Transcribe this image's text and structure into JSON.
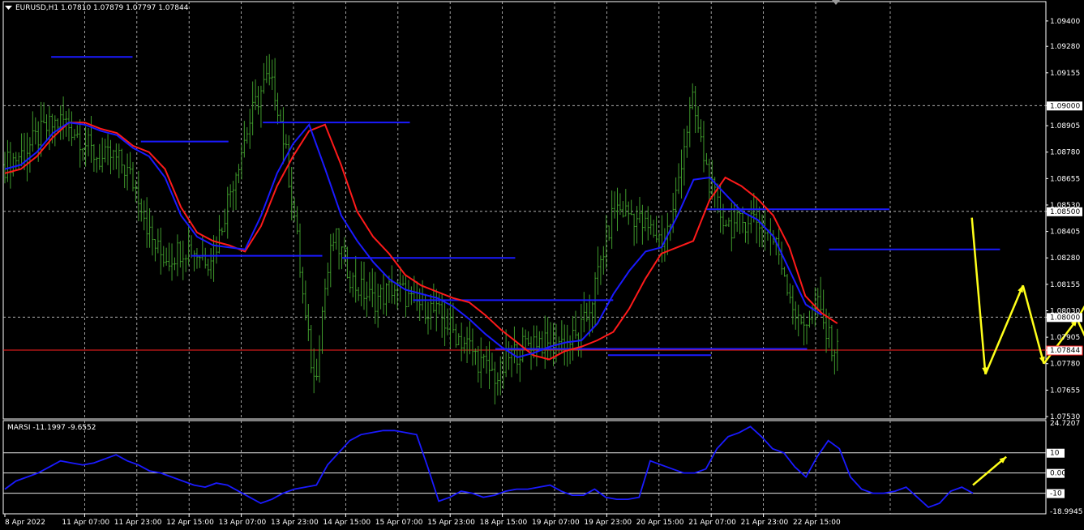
{
  "header": {
    "title": "EURUSD,H1  1.07810 1.07879 1.07797 1.07844"
  },
  "indicator_header": {
    "title": "MARSI -11.1997 -9.6552"
  },
  "colors": {
    "background": "#000000",
    "frame": "#ffffff",
    "grid": "#c8c8c8",
    "candles": "#3f9a2c",
    "ma_fast": "#1a1aff",
    "ma_slow": "#ff1a1a",
    "levels": "#1a1aff",
    "price_line": "#ff2020",
    "arrows": "#ffff1a",
    "rsi": "#1a1aff"
  },
  "chart_data": [
    {
      "type": "candlestick",
      "symbol": "EURUSD",
      "timeframe": "H1",
      "ohlc_last": {
        "open": 1.0781,
        "high": 1.07879,
        "low": 1.07797,
        "close": 1.07844
      },
      "ylim": [
        1.0753,
        1.0948
      ],
      "y_ticks": [
        "1.09400",
        "1.09280",
        "1.09155",
        "1.09000",
        "1.08905",
        "1.08780",
        "1.08655",
        "1.08530",
        "1.08500",
        "1.08405",
        "1.08280",
        "1.08155",
        "1.08030",
        "1.08000",
        "1.07905",
        "1.07844",
        "1.07780",
        "1.07655",
        "1.07530"
      ],
      "boxed_ticks": [
        "1.09000",
        "1.08500",
        "1.08000"
      ],
      "current_price": "1.07844",
      "x_ticks": [
        "8 Apr 2022",
        "11 Apr 07:00",
        "11 Apr 23:00",
        "12 Apr 15:00",
        "13 Apr 07:00",
        "13 Apr 23:00",
        "14 Apr 15:00",
        "15 Apr 07:00",
        "15 Apr 23:00",
        "18 Apr 15:00",
        "19 Apr 07:00",
        "19 Apr 23:00",
        "20 Apr 15:00",
        "21 Apr 07:00",
        "21 Apr 23:00",
        "22 Apr 15:00"
      ],
      "close_path": [
        1.0872,
        1.0875,
        1.0878,
        1.0883,
        1.0888,
        1.0891,
        1.0893,
        1.0889,
        1.0884,
        1.0878,
        1.0874,
        1.0876,
        1.0873,
        1.0866,
        1.0856,
        1.0838,
        1.083,
        1.0828,
        1.0832,
        1.0833,
        1.083,
        1.0828,
        1.0836,
        1.0855,
        1.0872,
        1.0888,
        1.0902,
        1.0912,
        1.0906,
        1.0878,
        1.0845,
        1.08,
        1.0768,
        1.0812,
        1.0838,
        1.0828,
        1.0816,
        1.0812,
        1.0808,
        1.081,
        1.0814,
        1.0812,
        1.0807,
        1.0806,
        1.0804,
        1.08,
        1.0795,
        1.079,
        1.0786,
        1.0779,
        1.0775,
        1.0771,
        1.0781,
        1.0784,
        1.0788,
        1.079,
        1.0786,
        1.0789,
        1.0788,
        1.079,
        1.0798,
        1.0815,
        1.0835,
        1.0852,
        1.085,
        1.0848,
        1.0843,
        1.084,
        1.0836,
        1.0848,
        1.0878,
        1.0902,
        1.088,
        1.086,
        1.0848,
        1.0843,
        1.0844,
        1.0848,
        1.0845,
        1.084,
        1.083,
        1.0813,
        1.0796,
        1.08,
        1.0805,
        1.079,
        1.0784
      ],
      "ma_fast": [
        1.087,
        1.0872,
        1.0878,
        1.0887,
        1.0892,
        1.0891,
        1.0888,
        1.0886,
        1.088,
        1.0876,
        1.0866,
        1.0848,
        1.0838,
        1.0834,
        1.0833,
        1.0832,
        1.0848,
        1.0868,
        1.0882,
        1.0891,
        1.087,
        1.0848,
        1.0836,
        1.0826,
        1.0818,
        1.0813,
        1.0811,
        1.0809,
        1.0805,
        1.0799,
        1.0792,
        1.0786,
        1.0781,
        1.0783,
        1.0786,
        1.0788,
        1.0789,
        1.0797,
        1.0811,
        1.0822,
        1.0831,
        1.0833,
        1.0848,
        1.0865,
        1.0866,
        1.0858,
        1.085,
        1.0846,
        1.0838,
        1.0822,
        1.0806,
        1.0801
      ],
      "ma_slow": [
        1.0868,
        1.087,
        1.0876,
        1.0885,
        1.0892,
        1.0892,
        1.0889,
        1.0887,
        1.0881,
        1.0878,
        1.087,
        1.0852,
        1.084,
        1.0836,
        1.0834,
        1.0831,
        1.0843,
        1.0862,
        1.0876,
        1.0888,
        1.0891,
        1.0872,
        1.085,
        1.0838,
        1.083,
        1.082,
        1.0815,
        1.0812,
        1.0809,
        1.0807,
        1.0801,
        1.0794,
        1.0788,
        1.0782,
        1.078,
        1.0784,
        1.0786,
        1.0789,
        1.0793,
        1.0804,
        1.0818,
        1.083,
        1.0833,
        1.0836,
        1.0855,
        1.0866,
        1.0862,
        1.0856,
        1.0848,
        1.0833,
        1.081,
        1.0802,
        1.0797
      ],
      "levels": [
        {
          "x": [
            0.046,
            0.124
          ],
          "y": 1.0923
        },
        {
          "x": [
            0.132,
            0.216
          ],
          "y": 1.0883
        },
        {
          "x": [
            0.18,
            0.306
          ],
          "y": 1.0829
        },
        {
          "x": [
            0.249,
            0.39
          ],
          "y": 1.0892
        },
        {
          "x": [
            0.325,
            0.491
          ],
          "y": 1.0828
        },
        {
          "x": [
            0.393,
            0.585
          ],
          "y": 1.0808
        },
        {
          "x": [
            0.472,
            0.771
          ],
          "y": 1.0785
        },
        {
          "x": [
            0.58,
            0.679
          ],
          "y": 1.0782
        },
        {
          "x": [
            0.673,
            0.85
          ],
          "y": 1.0851
        },
        {
          "x": [
            0.792,
            0.956
          ],
          "y": 1.0832
        }
      ],
      "arrows": [
        {
          "from": [
            0.929,
            1.0847
          ],
          "to": [
            0.942,
            1.0773
          ]
        },
        {
          "from": [
            0.942,
            1.0773
          ],
          "to": [
            0.978,
            1.0815
          ]
        },
        {
          "from": [
            0.978,
            1.0815
          ],
          "to": [
            0.998,
            1.0778
          ]
        },
        {
          "from": [
            0.998,
            1.0778
          ],
          "to": [
            1.03,
            1.0799
          ]
        },
        {
          "from": [
            1.03,
            1.0799
          ],
          "to": [
            1.055,
            1.0772
          ]
        },
        {
          "from": [
            1.03,
            1.0799
          ],
          "to": [
            1.05,
            1.0816
          ]
        }
      ]
    },
    {
      "type": "line",
      "name": "MARSI",
      "values_last": [
        -11.1997,
        -9.6552
      ],
      "ylim": [
        -18.9945,
        24.7207
      ],
      "y_ticks": [
        "24.7207",
        "10",
        "0.00",
        "-10",
        "-18.9945"
      ],
      "levels": [
        10,
        0,
        -10
      ],
      "series": [
        {
          "values": [
            -8,
            -4,
            -2,
            0,
            3,
            6,
            5,
            4,
            5,
            7,
            9,
            6,
            4,
            1,
            0,
            -2,
            -4,
            -6,
            -7,
            -5,
            -6,
            -9,
            -12,
            -15,
            -13,
            -10,
            -8,
            -7,
            -6,
            4,
            10,
            16,
            19,
            20,
            21,
            21,
            20,
            19,
            3,
            -14,
            -12,
            -9,
            -10,
            -12,
            -11,
            -9,
            -8,
            -8,
            -7,
            -6,
            -9,
            -11,
            -11,
            -8,
            -12,
            -13,
            -13,
            -12,
            6,
            4,
            2,
            0,
            0,
            2,
            12,
            18,
            20,
            23,
            18,
            12,
            10,
            3,
            -2,
            8,
            16,
            12,
            -2,
            -8,
            -10,
            -10,
            -9,
            -7,
            -12,
            -17,
            -15,
            -9,
            -7,
            -10
          ]
        },
        {
          "x_extent": 0.93
        }
      ],
      "arrow": {
        "from": [
          0.93,
          -6
        ],
        "to": [
          0.962,
          8
        ]
      }
    }
  ]
}
